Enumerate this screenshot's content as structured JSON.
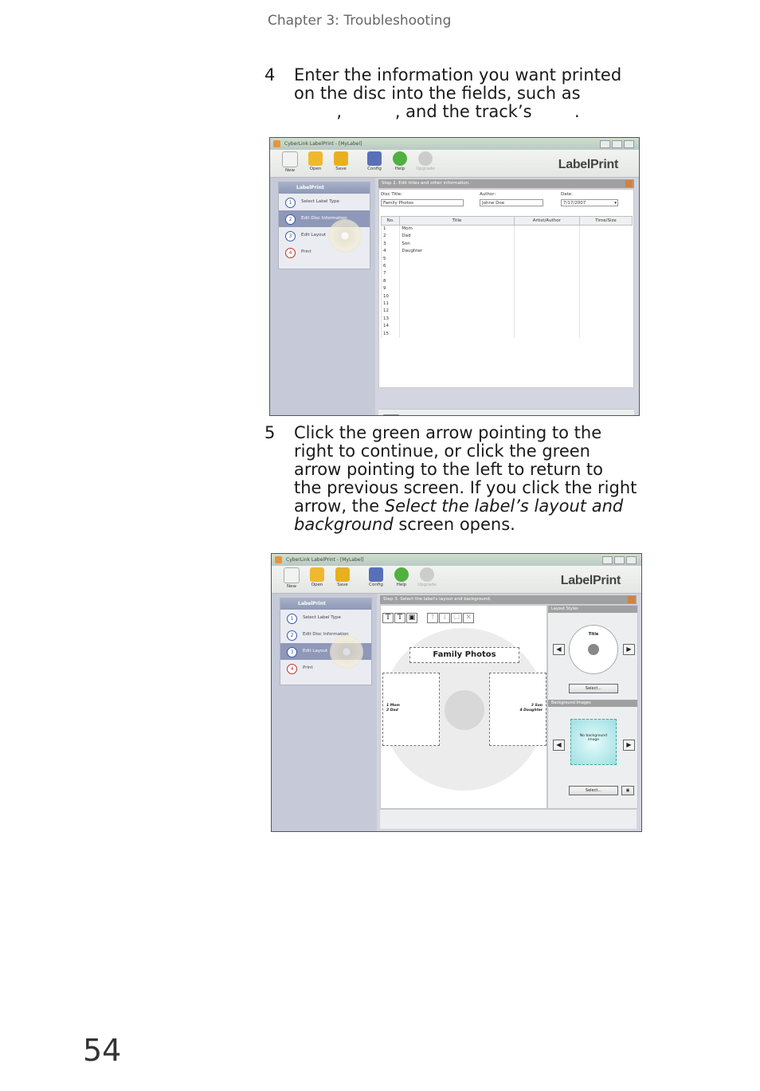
{
  "header": "Chapter 3: Troubleshooting",
  "step4": {
    "num": "4",
    "line1": "Enter the information you want printed",
    "line2": "on the disc into the fields, such as",
    "line3": "        ,          , and the track’s        ."
  },
  "step5": {
    "num": "5",
    "line1": "Click the green arrow pointing to the",
    "line2": "right to continue, or click the green",
    "line3": "arrow pointing to the left to return to",
    "line4": "the previous screen. If you click the right",
    "line5a": "arrow, the ",
    "line5b": "Select the label’s layout and",
    "line6a": "background",
    "line6b": " screen opens."
  },
  "page_number": "54",
  "app": {
    "title": "CyberLink LabelPrint - [MyLabel]",
    "brand": "LabelPrint",
    "toolbar": {
      "new": "New",
      "open": "Open",
      "save": "Save",
      "config": "Config",
      "help": "Help",
      "upgrade": "Upgrade"
    },
    "panel_title": "LabelPrint",
    "steps": [
      {
        "num": "1",
        "label": "Select Label Type"
      },
      {
        "num": "2",
        "label": "Edit Disc Information"
      },
      {
        "num": "3",
        "label": "Edit Layout"
      },
      {
        "num": "4",
        "label": "Print"
      }
    ]
  },
  "screen1": {
    "heading": "Step 2. Edit titles and other information.",
    "disc_title_label": "Disc Title:",
    "disc_title_value": "Family Photos",
    "author_label": "Author:",
    "author_value": "Johne Doe",
    "date_label": "Date:",
    "date_value": "7/17/2007",
    "columns": [
      "No.",
      "Title",
      "Artist/Author",
      "Time/Size"
    ],
    "rows": [
      [
        "1",
        "Mom"
      ],
      [
        "2",
        "Dad"
      ],
      [
        "3",
        "Son"
      ],
      [
        "4",
        "Daughter"
      ],
      [
        "5",
        ""
      ],
      [
        "6",
        ""
      ],
      [
        "7",
        ""
      ],
      [
        "8",
        ""
      ],
      [
        "9",
        ""
      ],
      [
        "10",
        ""
      ],
      [
        "11",
        ""
      ],
      [
        "12",
        ""
      ],
      [
        "13",
        ""
      ],
      [
        "14",
        ""
      ],
      [
        "15",
        ""
      ]
    ]
  },
  "screen2": {
    "heading": "Step 3. Select the label's layout and background.",
    "label_title": "Family Photos",
    "left_tracks": [
      "1  Mom",
      "2  Dad"
    ],
    "right_tracks": [
      "3  Son",
      "4  Daughter"
    ],
    "layout_style_label": "Layout Styles",
    "layout_preview_title": "Title",
    "select_label": "Select...",
    "background_label": "Background Images",
    "no_bg_text": "No background image",
    "select2_label": "Select..."
  },
  "colors": {
    "accent_green": "#2c9a3c",
    "sidebar": "#c6cad8",
    "selected": "#8f98b8"
  }
}
